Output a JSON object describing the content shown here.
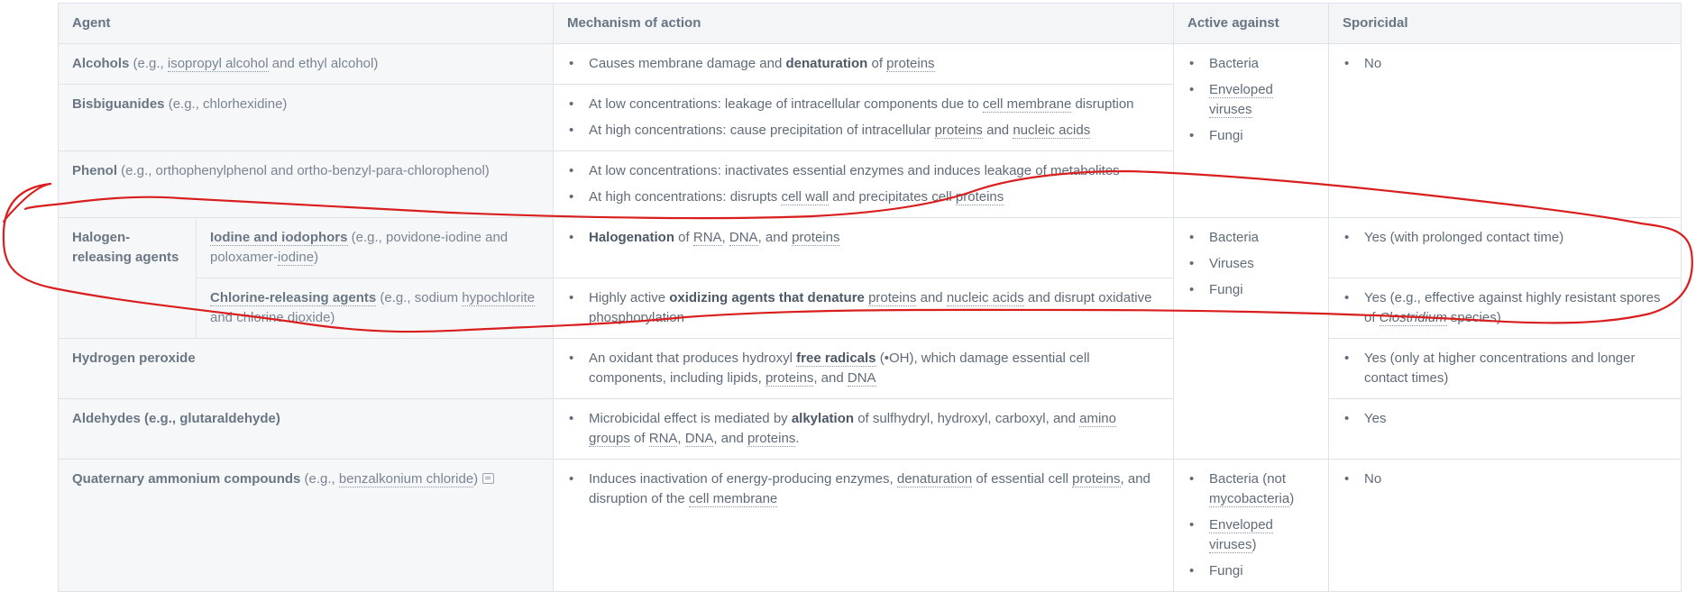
{
  "table": {
    "headers": [
      "Agent",
      "Mechanism of action",
      "Active against",
      "Sporicidal"
    ],
    "rows": {
      "alcohols": {
        "name": "Alcohols",
        "eg_prefix": " (e.g., ",
        "eg_link1": "isopropyl alcohol",
        "eg_mid": " and ethyl alcohol)",
        "mech": [
          {
            "t1": "Causes membrane damage and ",
            "s1": "denaturation",
            "t2": " of ",
            "l1": "proteins"
          }
        ]
      },
      "bisbiguanides": {
        "name": "Bisbiguanides",
        "eg": " (e.g., chlorhexidine)",
        "mech": [
          {
            "t1": "At low concentrations: leakage of intracellular components due to ",
            "l1": "cell membrane",
            "t2": " disruption"
          },
          {
            "t1": "At high concentrations: cause precipitation of intracellular ",
            "l1": "proteins",
            "t2": " and ",
            "l2": "nucleic acids"
          }
        ]
      },
      "phenol": {
        "name": "Phenol",
        "eg": " (e.g., orthophenylphenol and ortho-benzyl-para-chlorophenol)",
        "mech": [
          {
            "t1": "At low concentrations: inactivates essential enzymes and induces leakage of metabolites"
          },
          {
            "t1": "At high concentrations: disrupts ",
            "l1": "cell wall",
            "t2": " and precipitates cell ",
            "l2": "proteins"
          }
        ]
      },
      "group1_active": [
        "Bacteria",
        "Enveloped viruses",
        "Fungi"
      ],
      "group1_sporicidal": "No",
      "halogen": {
        "name": "Halogen-releasing agents",
        "iodine": {
          "name": "Iodine and iodophors",
          "eg1": " (e.g., povidone-iodine and poloxamer-",
          "eg_link": "iodine",
          "eg2": ")",
          "mech": {
            "s1": "Halogenation",
            "t1": " of ",
            "l1": "RNA",
            "t2": ", ",
            "l2": "DNA",
            "t3": ", and ",
            "l3": "proteins"
          },
          "sporicidal": "Yes (with prolonged contact time)"
        },
        "chlorine": {
          "name": "Chlorine-releasing agents",
          "eg1": " (e.g., sodium ",
          "eg_link": "hypochlorite",
          "eg2": " and chlorine dioxide)",
          "mech": {
            "t1": "Highly active ",
            "s1": "oxidizing agents that denature",
            "t2": " ",
            "l1": "proteins",
            "t3": " and ",
            "l2": "nucleic acids",
            "t4": " and disrupt oxidative phosphorylation"
          },
          "sporicidal_pre": "Yes (e.g., effective against highly resistant spores of ",
          "sporicidal_em": "Clostridium",
          "sporicidal_post": " species)"
        }
      },
      "group2_active": [
        "Bacteria",
        "Viruses",
        "Fungi"
      ],
      "peroxide": {
        "name": "Hydrogen peroxide",
        "mech": {
          "t1": "An oxidant that produces hydroxyl ",
          "s1": "free radicals",
          "t2": " (•OH), which damage essential cell components, including lipids, ",
          "l1": "proteins",
          "t3": ", and ",
          "l2": "DNA"
        },
        "sporicidal": "Yes (only at higher concentrations and longer contact times)"
      },
      "aldehydes": {
        "name": "Aldehydes (e.g., glutaraldehyde)",
        "mech": {
          "t1": "Microbicidal effect is mediated by ",
          "s1": "alkylation",
          "t2": " of sulfhydryl, hydroxyl, carboxyl, and ",
          "l1": "amino groups",
          "t3": " of ",
          "l2": "RNA",
          "t4": ", ",
          "l3": "DNA",
          "t5": ", and ",
          "l4": "proteins",
          "t6": "."
        },
        "sporicidal": "Yes"
      },
      "quats": {
        "name": "Quaternary ammonium compounds",
        "eg_prefix": " (e.g., ",
        "eg_link": "benzalkonium chloride",
        "eg_suffix": ")",
        "mech": {
          "t1": "Induces inactivation of energy-producing enzymes, ",
          "l1": "denaturation",
          "t2": " of essential cell ",
          "l2": "proteins",
          "t3": ", and disruption of the ",
          "l3": "cell membrane"
        },
        "active": [
          {
            "t": "Bacteria (not ",
            "l": "mycobacteria",
            "t2": ")"
          },
          {
            "l": "Enveloped viruses",
            "t2": ")"
          },
          {
            "t": "Fungi"
          }
        ],
        "sporicidal": "No"
      }
    }
  },
  "annotation": {
    "color": "#d91e1e",
    "description_icon": "note-icon"
  }
}
